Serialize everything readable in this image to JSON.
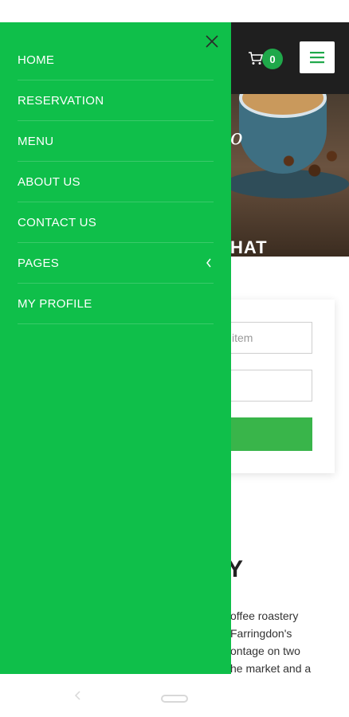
{
  "cart": {
    "count": "0"
  },
  "hero": {
    "script_fragment": "o",
    "title_fragment": "HAT"
  },
  "form": {
    "field1_placeholder": "item",
    "field2_placeholder": ""
  },
  "story": {
    "title_fragment": "Y",
    "lines": [
      "offee roastery",
      "Farringdon's",
      "ontage on two",
      "he market and a"
    ]
  },
  "drawer": {
    "close_icon": "close-icon",
    "items": [
      {
        "label": "HOME"
      },
      {
        "label": "RESERVATION"
      },
      {
        "label": "MENU"
      },
      {
        "label": "ABOUT US"
      },
      {
        "label": "CONTACT US"
      },
      {
        "label": "PAGES",
        "icon": "chevron-left-icon"
      },
      {
        "label": "MY PROFILE"
      }
    ]
  },
  "colors": {
    "drawer_bg": "#0fbf4a",
    "header_bg": "#1f1f1f",
    "accent": "#1fa84a"
  },
  "nav": {
    "back_icon": "back-icon",
    "home_icon": "home-pill-icon"
  }
}
